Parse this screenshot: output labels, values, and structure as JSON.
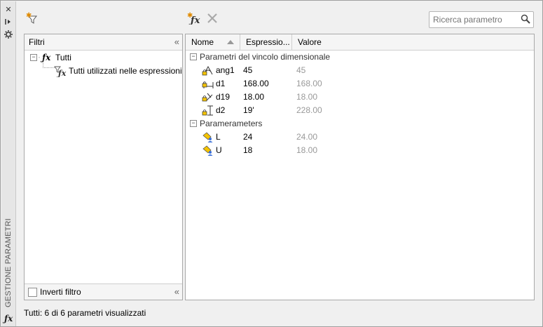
{
  "palette_title": "GESTIONE PARAMETRI",
  "search": {
    "placeholder": "Ricerca parametro"
  },
  "filters": {
    "header": "Filtri",
    "tree": [
      {
        "label": "Tutti"
      },
      {
        "label": "Tutti utilizzati nelle espressioni"
      }
    ],
    "invert_label": "Inverti filtro"
  },
  "grid": {
    "columns": [
      "Nome",
      "Espressio...",
      "Valore"
    ],
    "groups": [
      {
        "title": "Parametri del vincolo dimensionale",
        "rows": [
          {
            "name": "ang1",
            "expression": "45",
            "value": "45",
            "icon": "angular-constraint-icon"
          },
          {
            "name": "d1",
            "expression": "168.00",
            "value": "168.00",
            "icon": "horizontal-constraint-icon"
          },
          {
            "name": "d19",
            "expression": "18.00",
            "value": "18.00",
            "icon": "aligned-constraint-icon"
          },
          {
            "name": "d2",
            "expression": "19'",
            "value": "228.00",
            "icon": "vertical-constraint-icon"
          }
        ]
      },
      {
        "title": "Paramerameters",
        "rows": [
          {
            "name": "L",
            "expression": "24",
            "value": "24.00",
            "icon": "user-parameter-icon"
          },
          {
            "name": "U",
            "expression": "18",
            "value": "18.00",
            "icon": "user-parameter-icon"
          }
        ]
      }
    ]
  },
  "status_text": "Tutti: 6 di 6 parametri visualizzati"
}
